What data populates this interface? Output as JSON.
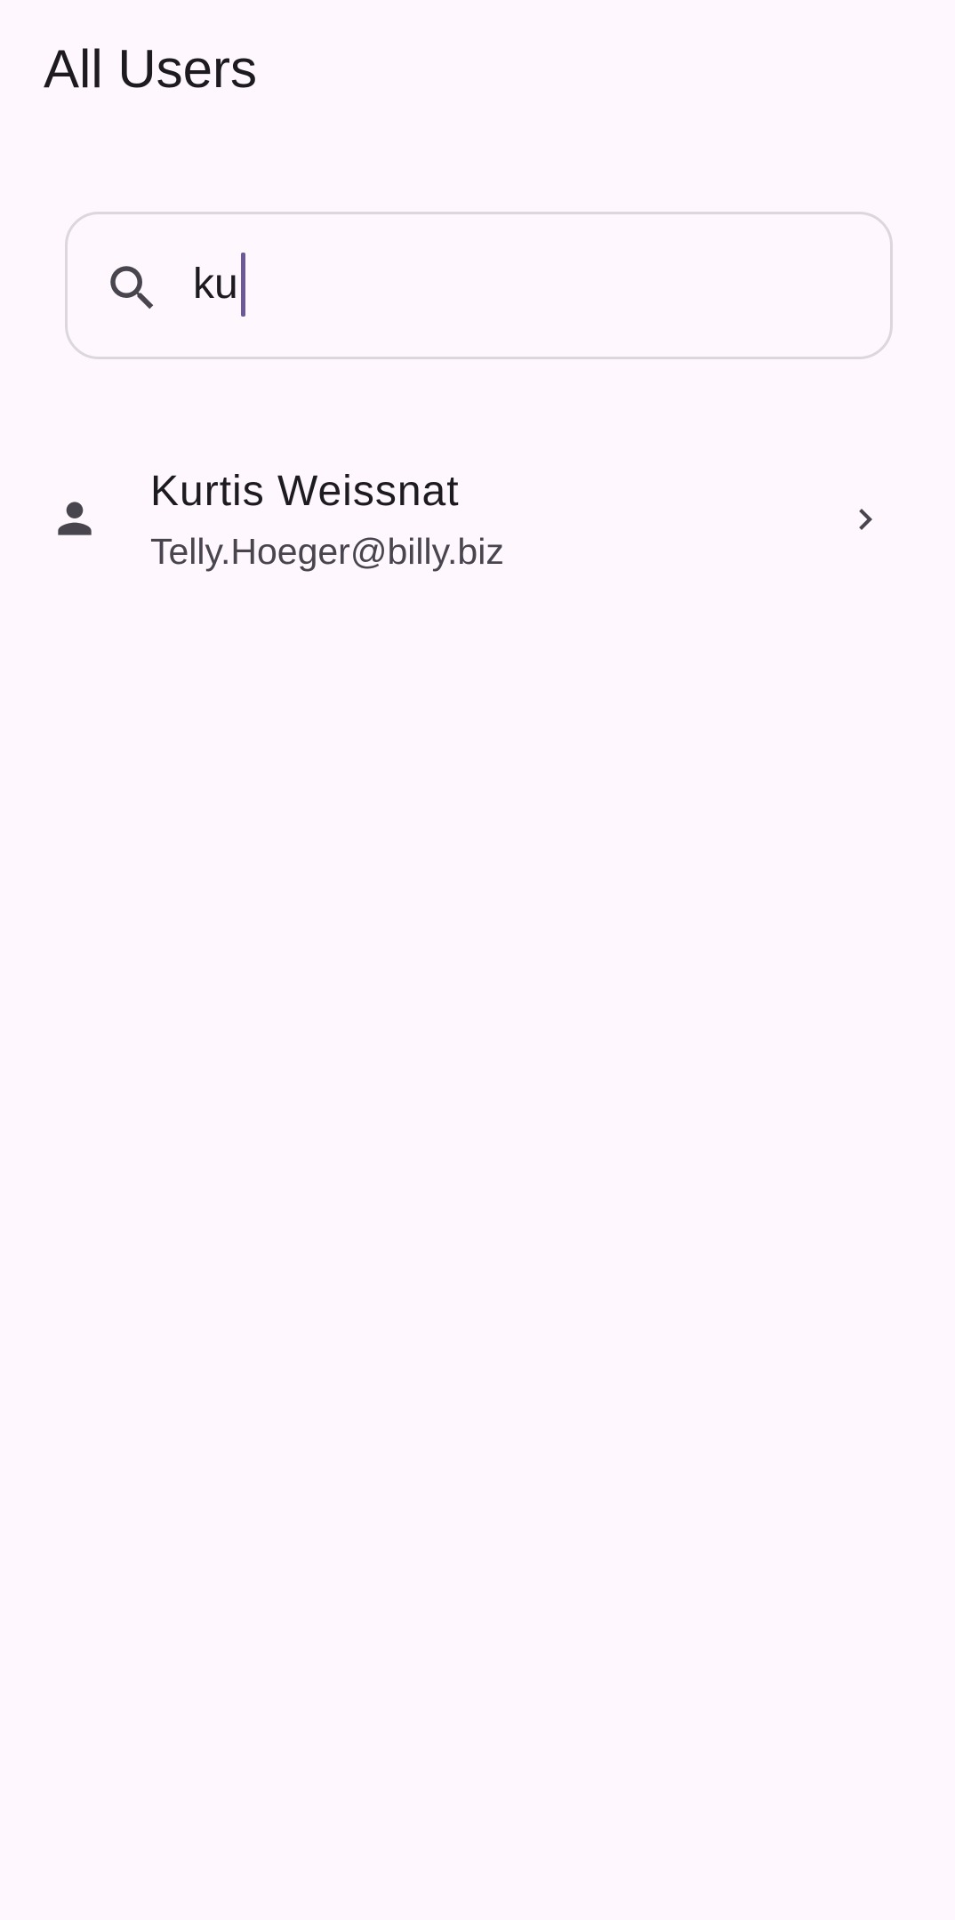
{
  "header": {
    "title": "All Users"
  },
  "search": {
    "value": "ku",
    "icon": "search-icon"
  },
  "users": [
    {
      "name": "Kurtis Weissnat",
      "email": "Telly.Hoeger@billy.biz",
      "icon": "person-icon",
      "trailing_icon": "chevron-right-icon"
    }
  ],
  "colors": {
    "background": "#fef7fe",
    "text_primary": "#1d1b20",
    "text_secondary": "#49454f",
    "icon": "#49454f",
    "border": "#dcd7dd",
    "caret": "#6b5a96"
  }
}
